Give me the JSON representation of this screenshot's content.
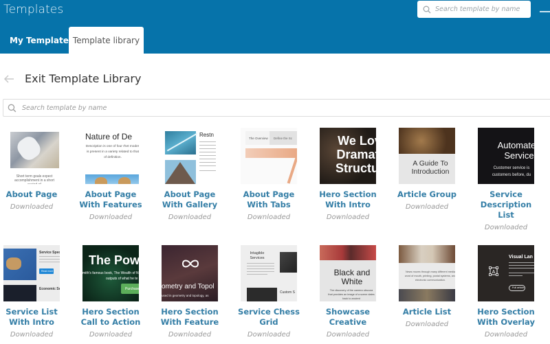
{
  "header": {
    "title": "Templates",
    "search_placeholder": "Search template by name",
    "tabs": [
      {
        "label": "My Templates",
        "active": false
      },
      {
        "label": "Template library",
        "active": true
      }
    ],
    "accent_color": "#0673aa"
  },
  "main": {
    "back_title": "Exit Template Library",
    "search_placeholder": "Search template by name",
    "templates": [
      {
        "name": "About Page",
        "status": "Downloaded",
        "thumb_text": "Short term goals expect accomplishment in a short period of"
      },
      {
        "name": "About Page With Features",
        "status": "Downloaded",
        "thumb_title": "Nature of De",
        "thumb_text": "Description is one of four rhet modes is present in a variety related to that of definition."
      },
      {
        "name": "About Page With Gallery",
        "status": "Downloaded",
        "thumb_title": "Restn"
      },
      {
        "name": "About Page With Tabs",
        "status": "Downloaded",
        "thumb_tabs": [
          "The Overview",
          "Define the Sc"
        ]
      },
      {
        "name": "Hero Section With Intro",
        "status": "Downloaded",
        "thumb_title": "We Love Dramatic Structure"
      },
      {
        "name": "Article Group",
        "status": "Downloaded",
        "thumb_title": "A Guide To Introduction"
      },
      {
        "name": "Service Description List",
        "status": "Downloaded",
        "thumb_title": "Automated Service",
        "thumb_text": "Customer service is customers before, du"
      },
      {
        "name": "Service List With Intro",
        "status": "Downloaded",
        "thumb_title": "Service Spec",
        "thumb_title2": "Economic Se",
        "thumb_button": "Read more"
      },
      {
        "name": "Hero Section Call to Action",
        "status": "Downloaded",
        "thumb_title": "The Pow",
        "thumb_text": "mith's famous book, The Wealth of N",
        "thumb_text2": "outputs of what he te",
        "thumb_button": "Purchase"
      },
      {
        "name": "Hero Section With Feature",
        "status": "Downloaded",
        "thumb_title": "ometry and Topol",
        "thumb_text": "used in geometry and topology, as"
      },
      {
        "name": "Service Chess Grid",
        "status": "Downloaded",
        "thumb_title": "Intagible Services",
        "thumb_title2": "Custom S"
      },
      {
        "name": "Showcase Creative",
        "status": "Downloaded",
        "thumb_title": "Black and White",
        "thumb_text": "The discovery of the camera obscura that provides an image of a scene dates back to ancient"
      },
      {
        "name": "Article List",
        "status": "Downloaded",
        "thumb_text": "News moves through many different media word of mouth, printing, postal systems, and electronic communication."
      },
      {
        "name": "Hero Section With Overlay",
        "status": "Downloaded",
        "thumb_title": "Visual Lan",
        "thumb_button": "Full article"
      }
    ]
  }
}
